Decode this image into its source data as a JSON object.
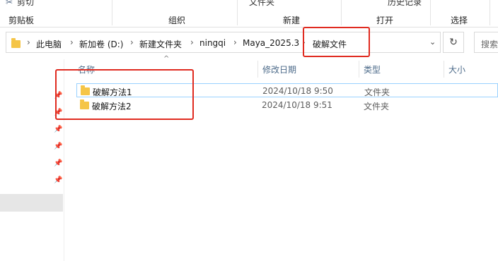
{
  "ribbon": {
    "top_cut_labels": {
      "cut": "剪切",
      "folder": "文件夹",
      "history": "历史记录"
    },
    "groups": [
      "剪贴板",
      "组织",
      "新建",
      "打开",
      "选择"
    ]
  },
  "address_bar": {
    "breadcrumbs": [
      "此电脑",
      "新加卷 (D:)",
      "新建文件夹",
      "ningqi",
      "Maya_2025.3",
      "破解文件"
    ]
  },
  "search": {
    "placeholder": "搜索"
  },
  "columns": {
    "name": "名称",
    "date": "修改日期",
    "type": "类型",
    "size": "大小"
  },
  "rows": [
    {
      "name": "破解方法1",
      "date": "2024/10/18 9:50",
      "type": "文件夹"
    },
    {
      "name": "破解方法2",
      "date": "2024/10/18 9:51",
      "type": "文件夹"
    }
  ],
  "colors": {
    "annotation": "#e02b20",
    "folder": "#f5c547",
    "selection_border": "#99d1ff"
  },
  "icons": [
    "scissors-icon",
    "folder-icon",
    "chevron-right-icon",
    "chevron-down-icon",
    "refresh-icon",
    "pin-icon",
    "sort-up-icon"
  ]
}
